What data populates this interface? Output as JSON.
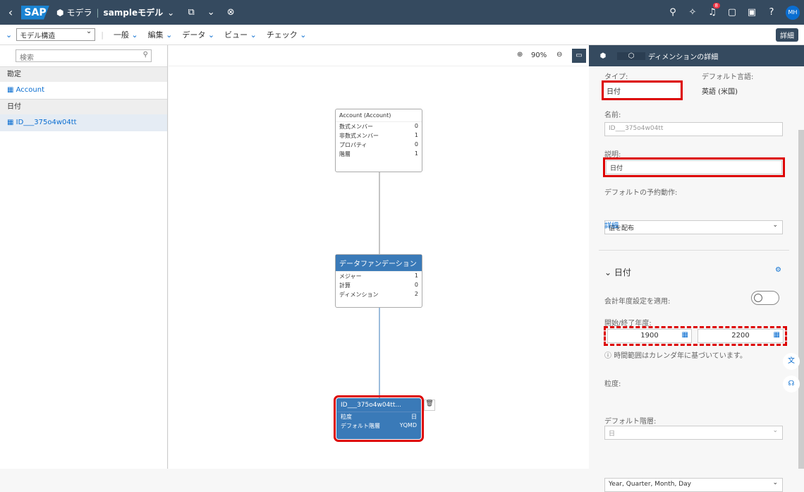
{
  "shell": {
    "logo": "SAP",
    "crumb_models": "モデラ",
    "model_name": "sampleモデル",
    "notif_count": "8",
    "avatar": "MH"
  },
  "toolbar": {
    "model_view": "モデル構造",
    "menus": [
      "一般",
      "編集",
      "データ",
      "ビュー",
      "チェック"
    ],
    "detail": "詳細"
  },
  "left": {
    "search_placeholder": "検索",
    "group_account": "勘定",
    "account_item": "Account",
    "group_date": "日付",
    "date_item": "ID___375o4w04tt"
  },
  "canvas": {
    "zoom": "90%",
    "account_node": {
      "title": "Account (Account)",
      "rows": [
        [
          "数式メンバー",
          "0"
        ],
        [
          "非数式メンバー",
          "1"
        ],
        [
          "プロパティ",
          "0"
        ],
        [
          "階層",
          "1"
        ]
      ]
    },
    "fact_node": {
      "title": "データファンデーション",
      "rows": [
        [
          "メジャー",
          "1"
        ],
        [
          "計算",
          "0"
        ],
        [
          "ディメンション",
          "2"
        ]
      ]
    },
    "date_node": {
      "title": "ID___375o4w04tt...",
      "rows": [
        [
          "粒度",
          "日"
        ],
        [
          "デフォルト階層",
          "YQMD"
        ]
      ]
    }
  },
  "right": {
    "tab_title": "ディメンションの詳細",
    "type_label": "タイプ:",
    "type_value": "日付",
    "lang_label": "デフォルト言語:",
    "lang_value": "英語 (米国)",
    "name_label": "名前:",
    "name_value": "ID___375o4w04tt",
    "desc_label": "説明:",
    "desc_value": "日付",
    "action_label": "デフォルトの予約動作:",
    "action_value": "値を配布",
    "detail_link": "詳細",
    "section_title": "日付",
    "fiscal_label": "会計年度設定を適用:",
    "years_label": "開始/終了年度:",
    "start_year": "1900",
    "end_year": "2200",
    "info_text": "時間範囲はカレンダ年に基づいています。",
    "gran_label": "粒度:",
    "gran_value": "日",
    "hier_label": "デフォルト階層:",
    "hier_value": "Year, Quarter, Month, Day"
  }
}
